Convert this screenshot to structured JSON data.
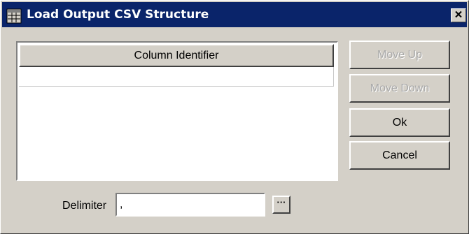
{
  "window": {
    "title": "Load Output CSV Structure",
    "icon": "table-icon",
    "close_icon": "close-icon"
  },
  "table": {
    "columns": [
      "Column Identifier"
    ],
    "rows": []
  },
  "buttons": {
    "move_up": "Move Up",
    "move_down": "Move Down",
    "ok": "Ok",
    "cancel": "Cancel"
  },
  "delimiter": {
    "label": "Delimiter",
    "value": ",",
    "browse_label": "···"
  },
  "colors": {
    "titlebar": "#0a246a",
    "face": "#d4d0c8",
    "disabled_text": "#a8a8a8"
  }
}
